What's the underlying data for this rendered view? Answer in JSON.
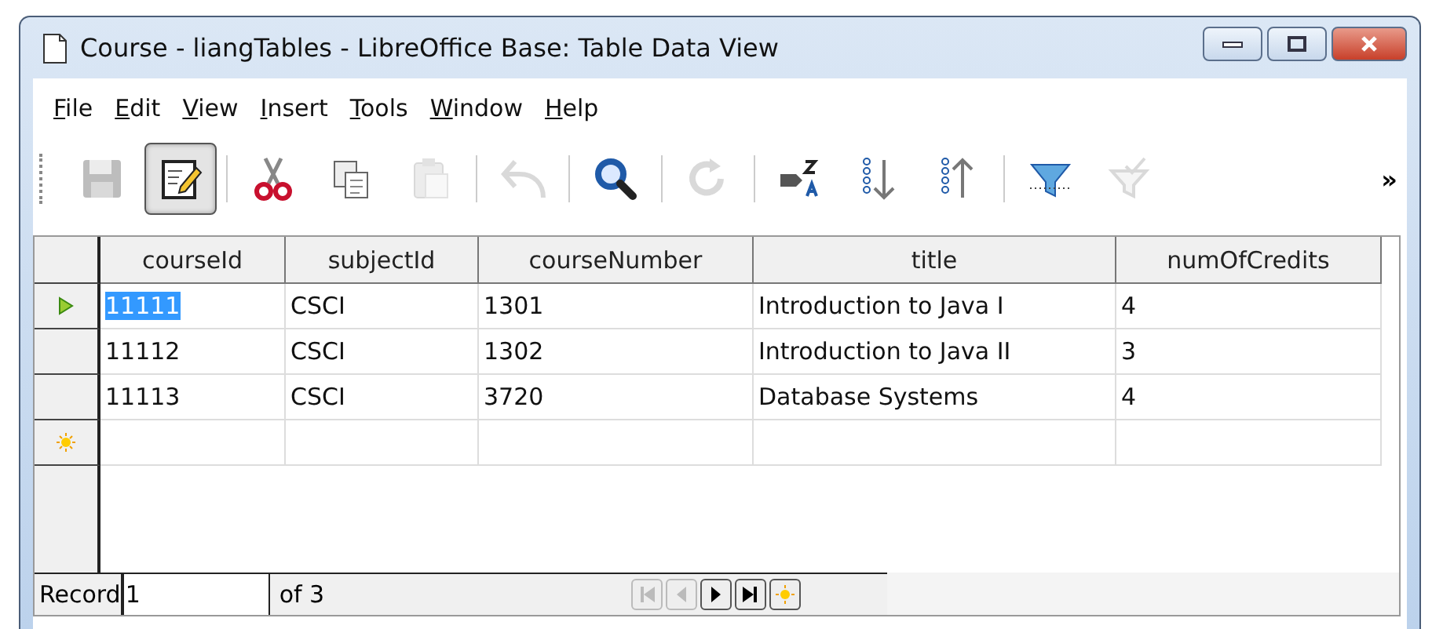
{
  "window": {
    "title": "Course - liangTables - LibreOffice Base: Table Data View"
  },
  "menu": [
    {
      "label": "File"
    },
    {
      "label": "Edit"
    },
    {
      "label": "View"
    },
    {
      "label": "Insert"
    },
    {
      "label": "Tools"
    },
    {
      "label": "Window"
    },
    {
      "label": "Help"
    }
  ],
  "toolbar": {
    "tools": [
      {
        "kind": "save",
        "disabled": true,
        "selected": false
      },
      {
        "kind": "edit",
        "disabled": false,
        "selected": true
      },
      {
        "kind": "sep"
      },
      {
        "kind": "cut",
        "disabled": false,
        "selected": false
      },
      {
        "kind": "copy",
        "disabled": false,
        "selected": false
      },
      {
        "kind": "paste",
        "disabled": true,
        "selected": false
      },
      {
        "kind": "sep"
      },
      {
        "kind": "undo",
        "disabled": true,
        "selected": false
      },
      {
        "kind": "sep"
      },
      {
        "kind": "find",
        "disabled": false,
        "selected": false
      },
      {
        "kind": "sep"
      },
      {
        "kind": "refresh",
        "disabled": true,
        "selected": false
      },
      {
        "kind": "sep"
      },
      {
        "kind": "sort",
        "disabled": false,
        "selected": false
      },
      {
        "kind": "sort-asc",
        "disabled": false,
        "selected": false
      },
      {
        "kind": "sort-desc",
        "disabled": false,
        "selected": false
      },
      {
        "kind": "sep"
      },
      {
        "kind": "autofilter",
        "disabled": false,
        "selected": false
      },
      {
        "kind": "filter",
        "disabled": true,
        "selected": false
      }
    ],
    "overflow": "»"
  },
  "table": {
    "columns": [
      "courseId",
      "subjectId",
      "courseNumber",
      "title",
      "numOfCredits"
    ],
    "rows": [
      {
        "current": true,
        "new_row": false,
        "cells": [
          "11111",
          "CSCI",
          "1301",
          "Introduction to Java I",
          "4"
        ]
      },
      {
        "current": false,
        "new_row": false,
        "cells": [
          "11112",
          "CSCI",
          "1302",
          "Introduction to Java II",
          "3"
        ]
      },
      {
        "current": false,
        "new_row": false,
        "cells": [
          "11113",
          "CSCI",
          "3720",
          "Database Systems",
          "4"
        ]
      },
      {
        "current": false,
        "new_row": true,
        "cells": []
      }
    ]
  },
  "record_bar": {
    "label": "Record",
    "value": "1",
    "count": "of 3",
    "buttons": [
      {
        "kind": "first",
        "disabled": true
      },
      {
        "kind": "prev",
        "disabled": true
      },
      {
        "kind": "next",
        "disabled": false
      },
      {
        "kind": "last",
        "disabled": false
      },
      {
        "kind": "new",
        "disabled": false
      }
    ]
  }
}
